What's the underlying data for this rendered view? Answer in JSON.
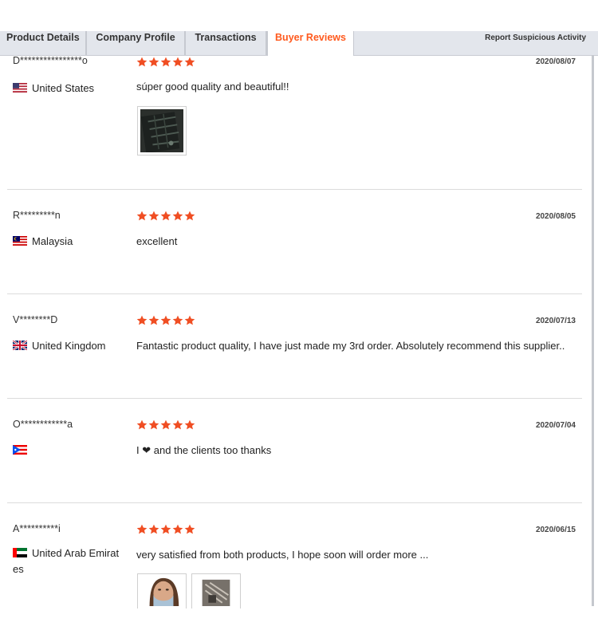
{
  "tabs": [
    {
      "label": "Product Details"
    },
    {
      "label": "Company Profile"
    },
    {
      "label": "Transactions"
    },
    {
      "label": "Buyer Reviews"
    }
  ],
  "report_label": "Report Suspicious Activity",
  "colors": {
    "accent": "#ff5a1e",
    "star": "#f04e23",
    "tab_bg": "#e3e6ec"
  },
  "reviews": [
    {
      "reviewer": "D****************o",
      "country": "United States",
      "flag": "us-flag-icon",
      "rating": 5,
      "date": "2020/08/07",
      "comment": "súper good quality and beautiful!!",
      "photos": 1
    },
    {
      "reviewer": "R*********n",
      "country": "Malaysia",
      "flag": "malaysia-flag-icon",
      "rating": 5,
      "date": "2020/08/05",
      "comment": "excellent",
      "photos": 0
    },
    {
      "reviewer": "V********D",
      "country": "United Kingdom",
      "flag": "uk-flag-icon",
      "rating": 5,
      "date": "2020/07/13",
      "comment": "Fantastic product quality, I have just made my 3rd order. Absolutely recommend this supplier..",
      "photos": 0
    },
    {
      "reviewer": "O************a",
      "country": "",
      "flag": "puerto-rico-flag-icon",
      "rating": 5,
      "date": "2020/07/04",
      "comment_before": "I",
      "comment_after": "and the clients too thanks",
      "photos": 0
    },
    {
      "reviewer": "A**********i",
      "country": "United Arab Emirates",
      "flag": "uae-flag-icon",
      "rating": 5,
      "date": "2020/06/15",
      "comment": "very satisfied from both products, I hope soon will order more ...",
      "photos": 2
    }
  ]
}
